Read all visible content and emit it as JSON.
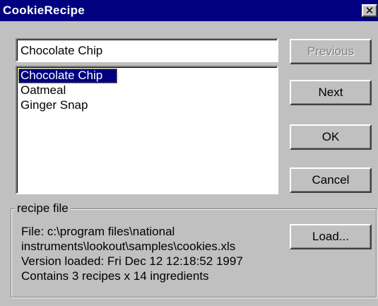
{
  "window": {
    "title": "CookieRecipe",
    "close_glyph": "✕"
  },
  "recipe_name_field": {
    "value": "Chocolate Chip"
  },
  "recipe_list": {
    "items": [
      {
        "label": "Chocolate Chip",
        "selected": true
      },
      {
        "label": "Oatmeal",
        "selected": false
      },
      {
        "label": "Ginger Snap",
        "selected": false
      }
    ]
  },
  "buttons": {
    "previous": {
      "label": "Previous",
      "enabled": false
    },
    "next": {
      "label": "Next",
      "enabled": true
    },
    "ok": {
      "label": "OK",
      "enabled": true
    },
    "cancel": {
      "label": "Cancel",
      "enabled": true
    },
    "load": {
      "label": "Load...",
      "enabled": true
    }
  },
  "recipe_file": {
    "group_label": "recipe file",
    "file_line1": "File: c:\\program files\\national",
    "file_line2": "instruments\\lookout\\samples\\cookies.xls",
    "version_line": "Version loaded: Fri Dec 12 12:18:52 1997",
    "contents_line": "Contains 3 recipes x 14 ingredients"
  },
  "colors": {
    "titlebar": "#000080",
    "face": "#c0c0c0",
    "selection": "#000080"
  }
}
